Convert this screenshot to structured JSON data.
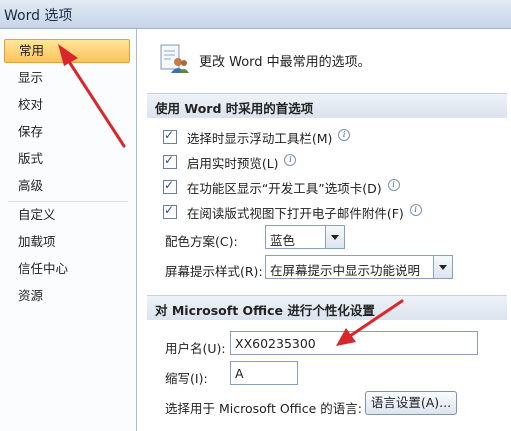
{
  "window": {
    "title": "Word 选项"
  },
  "sidebar": {
    "items": [
      {
        "label": "常用",
        "selected": true
      },
      {
        "label": "显示"
      },
      {
        "label": "校对"
      },
      {
        "label": "保存"
      },
      {
        "label": "版式"
      },
      {
        "label": "高级"
      },
      {
        "label": "自定义"
      },
      {
        "label": "加载项"
      },
      {
        "label": "信任中心"
      },
      {
        "label": "资源"
      }
    ]
  },
  "header": {
    "text": "更改 Word 中最常用的选项。",
    "icon": "options-people-icon"
  },
  "sections": {
    "word_options": {
      "title": "使用 Word 时采用的首选项",
      "checkboxes": [
        {
          "label": "选择时显示浮动工具栏(M)",
          "checked": true
        },
        {
          "label": "启用实时预览(L)",
          "checked": true
        },
        {
          "label": "在功能区显示“开发工具”选项卡(D)",
          "checked": true
        },
        {
          "label": "在阅读版式视图下打开电子邮件附件(F)",
          "checked": true
        }
      ],
      "color_scheme": {
        "label": "配色方案(C):",
        "value": "蓝色"
      },
      "screentip": {
        "label": "屏幕提示样式(R):",
        "value": "在屏幕提示中显示功能说明"
      }
    },
    "personalize": {
      "title": "对 Microsoft Office 进行个性化设置",
      "username": {
        "label": "用户名(U):",
        "value": "XX60235300"
      },
      "initials": {
        "label": "缩写(I):",
        "value": "A"
      },
      "language": {
        "label": "选择用于 Microsoft Office 的语言:",
        "button": "语言设置(A)..."
      }
    }
  },
  "annotations": {
    "arrow_color": "#d9262b"
  },
  "colors": {
    "selected_nav": "#ffc35a",
    "accent": "#2b4c8e"
  }
}
